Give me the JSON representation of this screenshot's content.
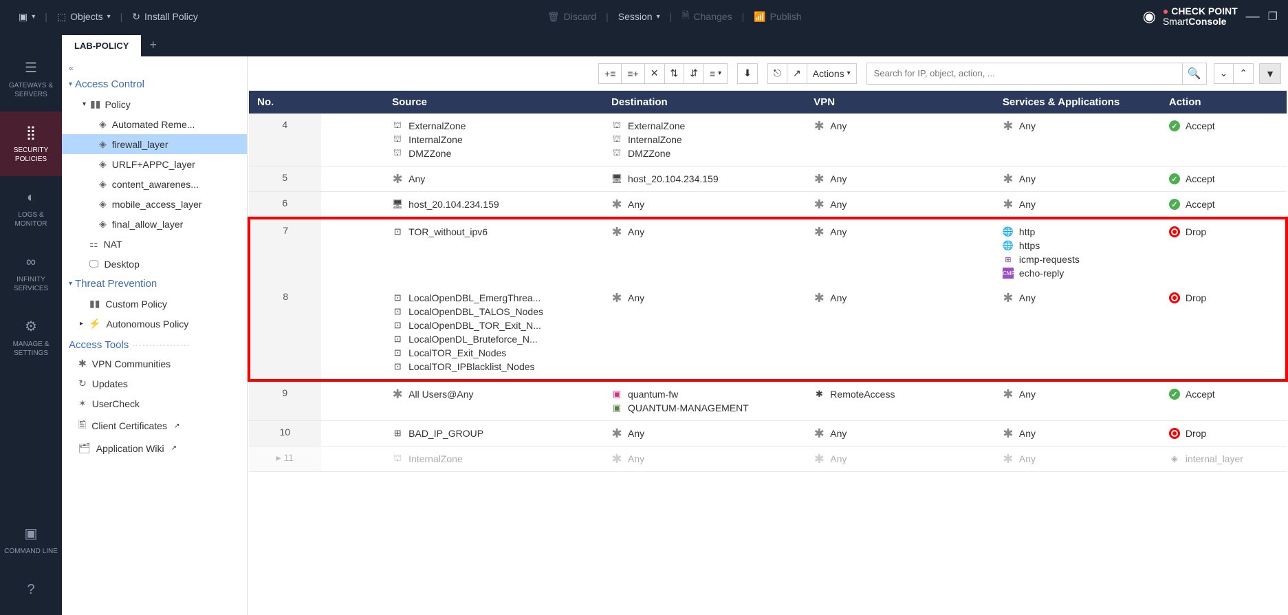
{
  "topbar": {
    "objects": "Objects",
    "install_policy": "Install Policy",
    "discard": "Discard",
    "session": "Session",
    "changes": "Changes",
    "publish": "Publish",
    "brand_top": "CHECK POINT",
    "brand_bottom_1": "Smart",
    "brand_bottom_2": "Console"
  },
  "leftnav": {
    "gateways": "GATEWAYS & SERVERS",
    "security": "SECURITY POLICIES",
    "logs": "LOGS & MONITOR",
    "infinity": "INFINITY SERVICES",
    "manage": "MANAGE & SETTINGS",
    "cli": "COMMAND LINE"
  },
  "tabs": {
    "active": "LAB-POLICY"
  },
  "sidebar": {
    "access_control": "Access Control",
    "policy": "Policy",
    "layers": {
      "l0": "Automated Reme...",
      "l1": "firewall_layer",
      "l2": "URLF+APPC_layer",
      "l3": "content_awarenes...",
      "l4": "mobile_access_layer",
      "l5": "final_allow_layer"
    },
    "nat": "NAT",
    "desktop": "Desktop",
    "threat_prevention": "Threat Prevention",
    "custom_policy": "Custom Policy",
    "autonomous_policy": "Autonomous Policy",
    "access_tools": "Access Tools",
    "tools": {
      "t0": "VPN Communities",
      "t1": "Updates",
      "t2": "UserCheck",
      "t3": "Client Certificates",
      "t4": "Application Wiki"
    }
  },
  "toolbar": {
    "actions": "Actions",
    "search_placeholder": "Search for IP, object, action, ..."
  },
  "grid": {
    "headers": {
      "no": "No.",
      "source": "Source",
      "destination": "Destination",
      "vpn": "VPN",
      "services": "Services & Applications",
      "action": "Action"
    },
    "rows": [
      {
        "no": "4",
        "source": [
          {
            "icon": "zone",
            "text": "ExternalZone"
          },
          {
            "icon": "zone",
            "text": "InternalZone"
          },
          {
            "icon": "zone",
            "text": "DMZZone"
          }
        ],
        "destination": [
          {
            "icon": "zone",
            "text": "ExternalZone"
          },
          {
            "icon": "zone",
            "text": "InternalZone"
          },
          {
            "icon": "zone",
            "text": "DMZZone"
          }
        ],
        "vpn": [
          {
            "icon": "any",
            "text": "Any"
          }
        ],
        "services": [
          {
            "icon": "any",
            "text": "Any"
          }
        ],
        "action": {
          "icon": "accept",
          "text": "Accept"
        }
      },
      {
        "no": "5",
        "source": [
          {
            "icon": "any",
            "text": "Any"
          }
        ],
        "destination": [
          {
            "icon": "host",
            "text": "host_20.104.234.159"
          }
        ],
        "vpn": [
          {
            "icon": "any",
            "text": "Any"
          }
        ],
        "services": [
          {
            "icon": "any",
            "text": "Any"
          }
        ],
        "action": {
          "icon": "accept",
          "text": "Accept"
        }
      },
      {
        "no": "6",
        "source": [
          {
            "icon": "host",
            "text": "host_20.104.234.159"
          }
        ],
        "destination": [
          {
            "icon": "any",
            "text": "Any"
          }
        ],
        "vpn": [
          {
            "icon": "any",
            "text": "Any"
          }
        ],
        "services": [
          {
            "icon": "any",
            "text": "Any"
          }
        ],
        "action": {
          "icon": "accept",
          "text": "Accept"
        }
      },
      {
        "no": "7",
        "highlight": "start",
        "source": [
          {
            "icon": "group",
            "text": "TOR_without_ipv6"
          }
        ],
        "destination": [
          {
            "icon": "any",
            "text": "Any"
          }
        ],
        "vpn": [
          {
            "icon": "any",
            "text": "Any"
          }
        ],
        "services": [
          {
            "icon": "globe",
            "text": "http"
          },
          {
            "icon": "globe2",
            "text": "https"
          },
          {
            "icon": "icmp",
            "text": "icmp-requests"
          },
          {
            "icon": "icmp2",
            "text": "echo-reply"
          }
        ],
        "action": {
          "icon": "drop",
          "text": "Drop"
        }
      },
      {
        "no": "8",
        "highlight": "end",
        "source": [
          {
            "icon": "group",
            "text": "LocalOpenDBL_EmergThrea..."
          },
          {
            "icon": "group",
            "text": "LocalOpenDBL_TALOS_Nodes"
          },
          {
            "icon": "group",
            "text": "LocalOpenDBL_TOR_Exit_N..."
          },
          {
            "icon": "group",
            "text": "LocalOpenDL_Bruteforce_N..."
          },
          {
            "icon": "group",
            "text": "LocalTOR_Exit_Nodes"
          },
          {
            "icon": "group",
            "text": "LocalTOR_IPBlacklist_Nodes"
          }
        ],
        "destination": [
          {
            "icon": "any",
            "text": "Any"
          }
        ],
        "vpn": [
          {
            "icon": "any",
            "text": "Any"
          }
        ],
        "services": [
          {
            "icon": "any",
            "text": "Any"
          }
        ],
        "action": {
          "icon": "drop",
          "text": "Drop"
        }
      },
      {
        "no": "9",
        "source": [
          {
            "icon": "any",
            "text": "All Users@Any"
          }
        ],
        "destination": [
          {
            "icon": "fw",
            "text": "quantum-fw"
          },
          {
            "icon": "mgmt",
            "text": "QUANTUM-MANAGEMENT"
          }
        ],
        "vpn": [
          {
            "icon": "remote",
            "text": "RemoteAccess"
          }
        ],
        "services": [
          {
            "icon": "any",
            "text": "Any"
          }
        ],
        "action": {
          "icon": "accept",
          "text": "Accept"
        }
      },
      {
        "no": "10",
        "source": [
          {
            "icon": "group2",
            "text": "BAD_IP_GROUP"
          }
        ],
        "destination": [
          {
            "icon": "any",
            "text": "Any"
          }
        ],
        "vpn": [
          {
            "icon": "any",
            "text": "Any"
          }
        ],
        "services": [
          {
            "icon": "any",
            "text": "Any"
          }
        ],
        "action": {
          "icon": "drop",
          "text": "Drop"
        }
      },
      {
        "no": "11",
        "partial": true,
        "source": [
          {
            "icon": "zone",
            "text": "InternalZone"
          }
        ],
        "destination": [
          {
            "icon": "any",
            "text": "Any"
          }
        ],
        "vpn": [
          {
            "icon": "any",
            "text": "Any"
          }
        ],
        "services": [
          {
            "icon": "any",
            "text": "Any"
          }
        ],
        "action": {
          "icon": "layer",
          "text": "internal_layer"
        }
      }
    ]
  }
}
